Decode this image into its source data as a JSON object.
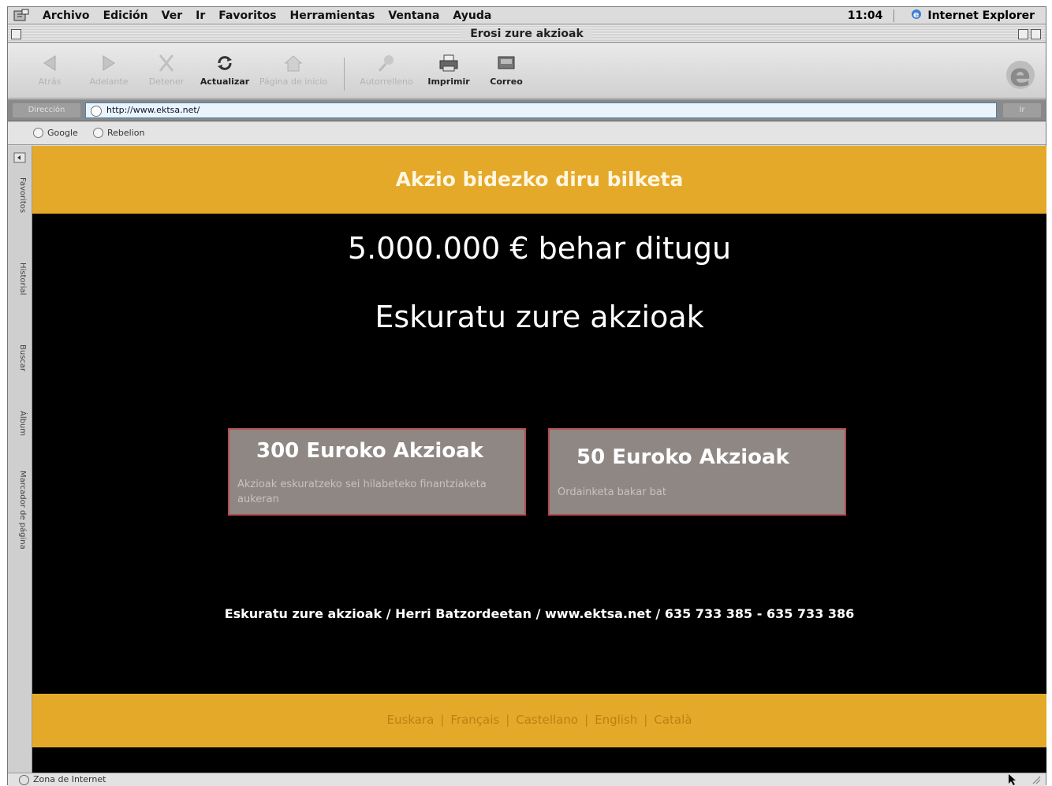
{
  "menu": {
    "items": [
      "Archivo",
      "Edición",
      "Ver",
      "Ir",
      "Favoritos",
      "Herramientas",
      "Ventana",
      "Ayuda"
    ],
    "clock": "11:04",
    "app_name": "Internet Explorer"
  },
  "window": {
    "title": "Erosi zure akzioak"
  },
  "toolbar": {
    "back": "Atrás",
    "forward": "Adelante",
    "stop": "Detener",
    "refresh": "Actualizar",
    "home": "Página de inicio",
    "autofill": "Autorrelleno",
    "print": "Imprimir",
    "mail": "Correo"
  },
  "address": {
    "label": "Dirección",
    "url": "http://www.ektsa.net/",
    "go": "Ir"
  },
  "favorites_bar": {
    "items": [
      "Google",
      "Rebelion"
    ]
  },
  "explorer_bar": {
    "tabs": [
      "Favoritos",
      "Historial",
      "Buscar",
      "Álbum",
      "Marcador de página"
    ]
  },
  "page": {
    "banner_title": "Akzio bidezko diru bilketa",
    "heading1": "5.000.000 € behar ditugu",
    "heading2": "Eskuratu zure akzioak",
    "options": [
      {
        "title": "300 Euroko Akzioak",
        "description": "Akzioak eskuratzeko sei hilabeteko finantziaketa aukeran"
      },
      {
        "title": "50 Euroko Akzioak",
        "description": "Ordainketa bakar bat"
      }
    ],
    "footer_line": "Eskuratu zure akzioak / Herri Batzordeetan / www.ektsa.net / 635 733 385 - 635 733 386",
    "languages": [
      "Euskara",
      "Français",
      "Castellano",
      "English",
      "Català"
    ],
    "language_separator": "|"
  },
  "status": {
    "zone": "Zona de Internet"
  },
  "colors": {
    "band": "#e5a92a",
    "background": "#000000",
    "option_box": "#8f8784",
    "option_border": "#b44d4d"
  }
}
